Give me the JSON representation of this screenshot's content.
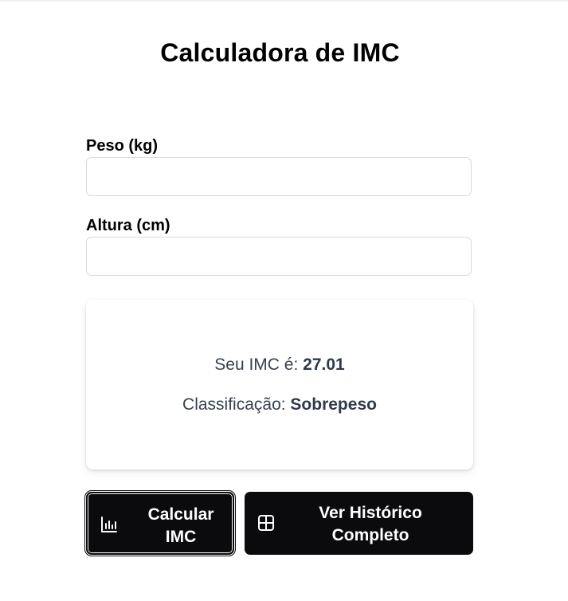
{
  "page": {
    "title": "Calculadora de IMC"
  },
  "form": {
    "weight_label": "Peso (kg)",
    "weight_value": "",
    "weight_placeholder": "",
    "height_label": "Altura (cm)",
    "height_value": "",
    "height_placeholder": ""
  },
  "result": {
    "imc_prefix": "Seu IMC é: ",
    "imc_value": "27.01",
    "class_prefix": "Classificação: ",
    "class_value": "Sobrepeso"
  },
  "actions": {
    "calculate_line1": "Calcular",
    "calculate_line2": "IMC",
    "calculate_icon": "bar-chart-icon",
    "history_line1": "Ver Histórico",
    "history_line2": "Completo",
    "history_icon": "table-icon"
  },
  "colors": {
    "button_bg": "#0b0a0c",
    "result_text": "#374151"
  }
}
